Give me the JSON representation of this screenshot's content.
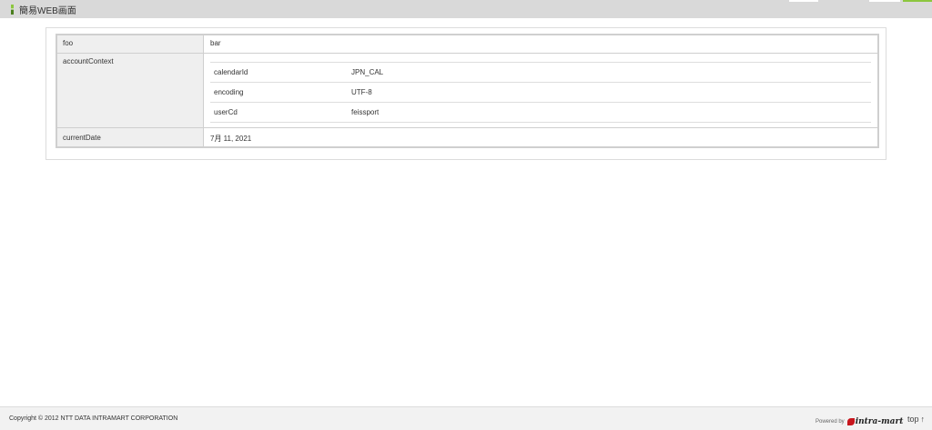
{
  "header": {
    "title": "簡易WEB画面"
  },
  "table": {
    "rows": [
      {
        "key": "foo",
        "value": "bar"
      },
      {
        "key": "accountContext"
      },
      {
        "key": "currentDate",
        "value": "7月 11, 2021"
      }
    ],
    "account_context": [
      {
        "key": "calendarId",
        "value": "JPN_CAL"
      },
      {
        "key": "encoding",
        "value": "UTF-8"
      },
      {
        "key": "userCd",
        "value": "feissport"
      }
    ]
  },
  "footer": {
    "copyright": "Copyright © 2012 NTT DATA INTRAMART CORPORATION",
    "powered_by": "Powered by",
    "logo_text": "intra-mart",
    "top_label": "top",
    "top_arrow": "↑"
  },
  "icons": {
    "title": "page-marker-icon",
    "logo": "intra-mart-logo",
    "top": "arrow-up-icon"
  },
  "colors": {
    "accent": "#8cc63f",
    "header_bg": "#d9d9d9",
    "key_cell_bg": "#efefef"
  }
}
